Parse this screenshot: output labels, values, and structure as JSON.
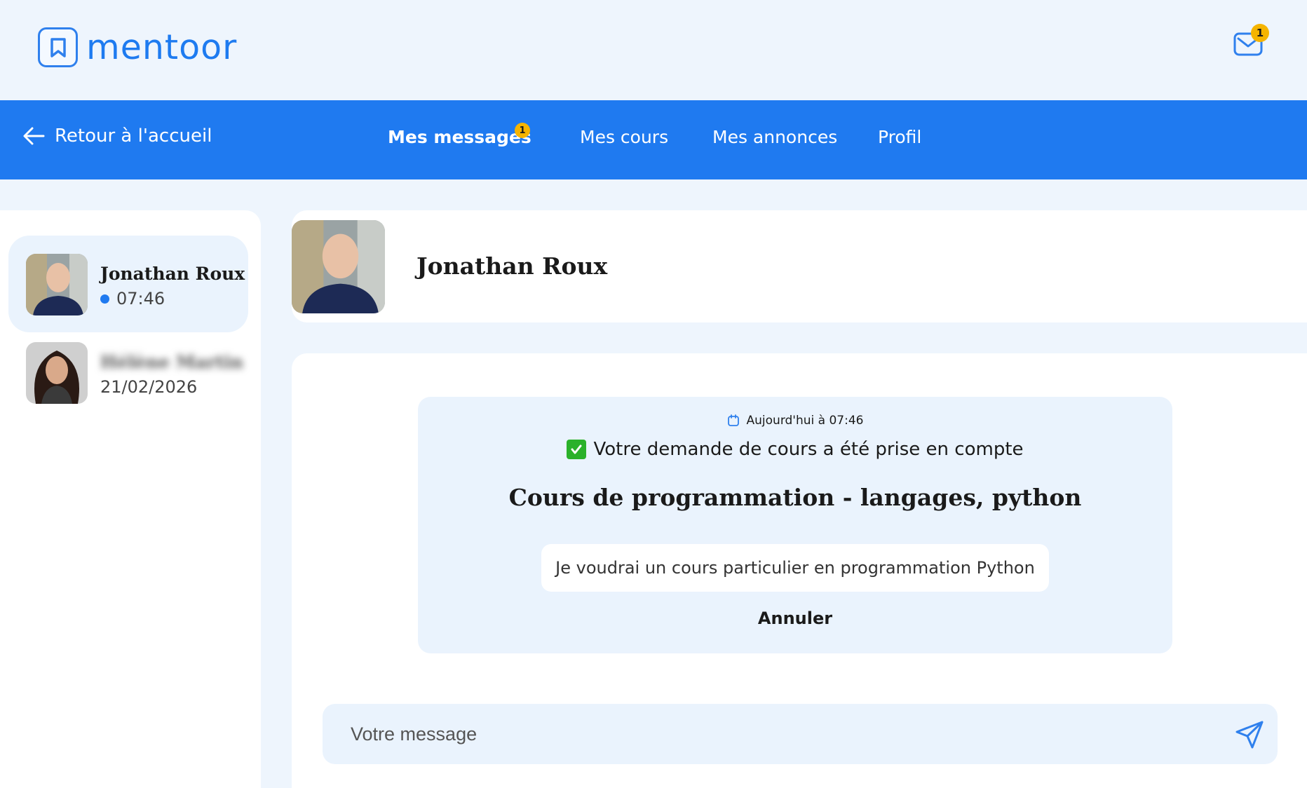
{
  "brand": {
    "name": "mentoor"
  },
  "header": {
    "mail_badge": "1"
  },
  "nav": {
    "back_label": "Retour à l'accueil",
    "items": [
      {
        "label": "Mes messages",
        "badge": "1",
        "active": true
      },
      {
        "label": "Mes cours"
      },
      {
        "label": "Mes annonces"
      },
      {
        "label": "Profil"
      }
    ]
  },
  "conversations": [
    {
      "name": "Jonathan Roux",
      "time": "07:46",
      "online": true,
      "active": true
    },
    {
      "name": "Hélène Martin",
      "time": "21/02/2026",
      "blurred": true
    }
  ],
  "chat": {
    "contact_name": "Jonathan Roux",
    "request": {
      "timestamp": "Aujourd'hui à 07:46",
      "status": "Votre demande de cours a été prise en compte",
      "title": "Cours de programmation - langages, python",
      "message": "Je voudrai un cours particulier en programmation Python",
      "cancel_label": "Annuler"
    },
    "composer": {
      "placeholder": "Votre message"
    }
  },
  "colors": {
    "primary": "#1f7af0",
    "badge": "#f5b400",
    "page_bg": "#eef5fd",
    "card_bg": "#eaf3fd"
  }
}
